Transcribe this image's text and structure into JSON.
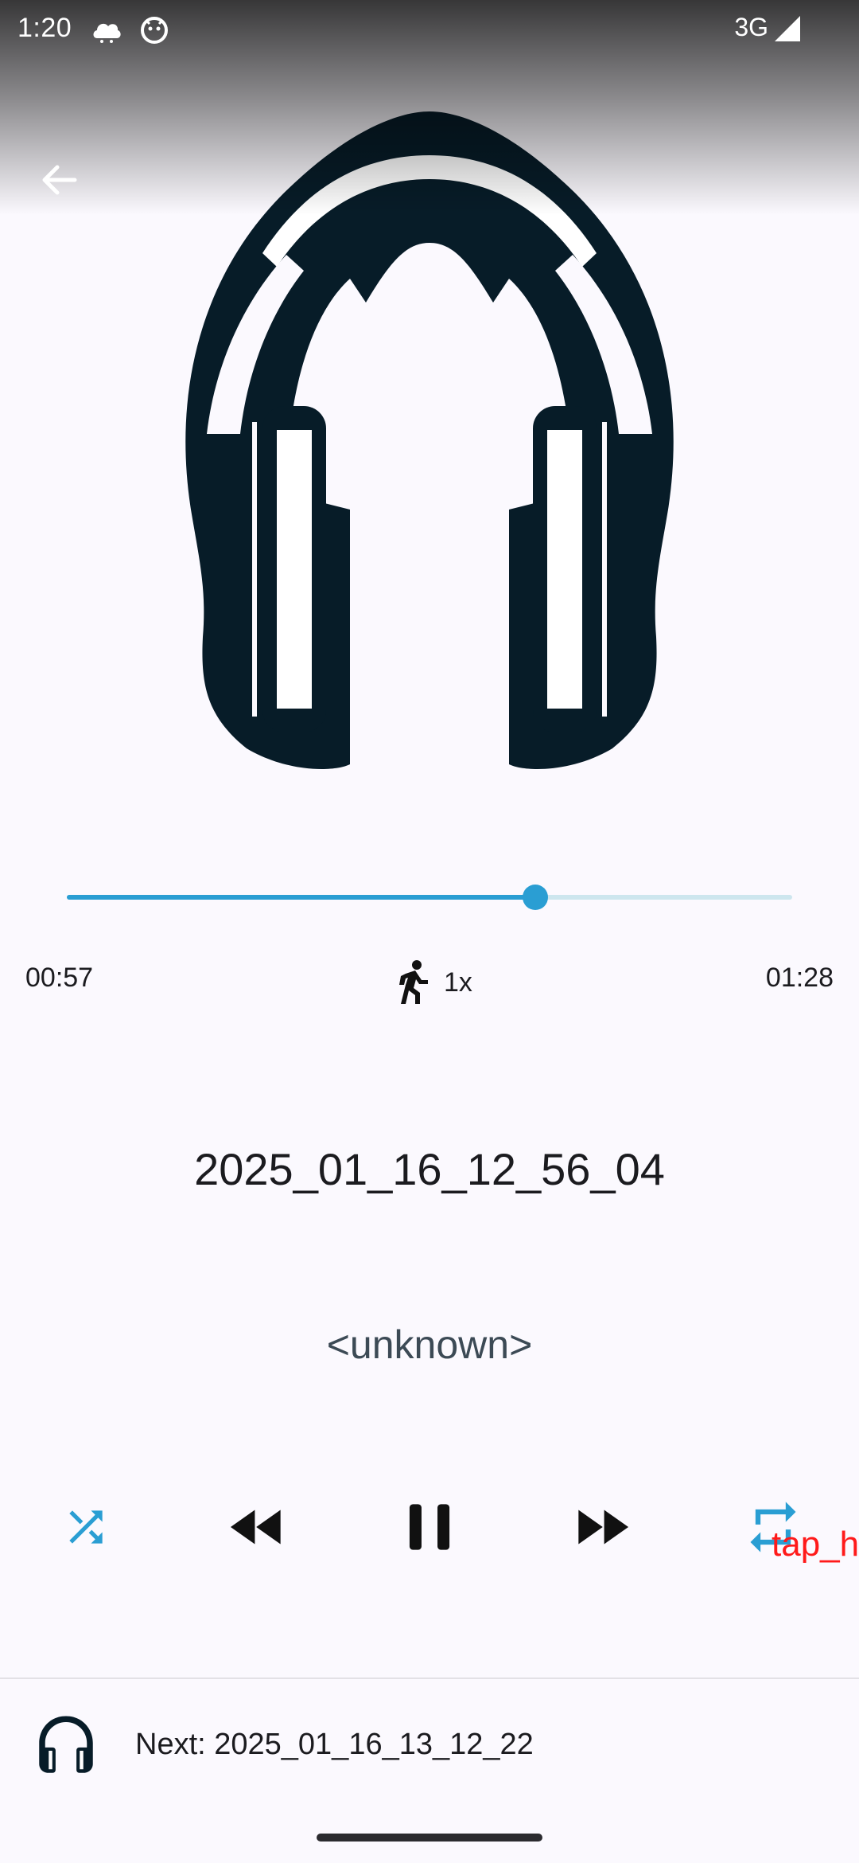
{
  "status_bar": {
    "time": "1:20",
    "network": "3G",
    "icons": [
      "cloud-icon",
      "android-debug-icon",
      "signal-icon"
    ]
  },
  "navigation": {
    "back_icon": "arrow-back-icon"
  },
  "artwork": {
    "icon": "headphones-icon"
  },
  "player": {
    "elapsed": "00:57",
    "duration": "01:28",
    "progress_fraction": 0.646,
    "speed_icon": "running-person-icon",
    "speed_label": "1x",
    "title": "2025_01_16_12_56_04",
    "artist": "<unknown>"
  },
  "controls": {
    "shuffle_icon": "shuffle-icon",
    "rewind_icon": "rewind-icon",
    "pause_icon": "pause-icon",
    "forward_icon": "fast-forward-icon",
    "repeat_icon": "repeat-icon"
  },
  "overlay": {
    "tap_hint": "tap_h"
  },
  "next": {
    "label": "Next: 2025_01_16_13_12_22",
    "icon": "headphones-icon"
  },
  "colors": {
    "accent": "#2a9ed3",
    "track_inactive": "#cde6ee",
    "icon_dark": "#071c28",
    "overlay_text": "#ff1a1a",
    "background": "#fbf9fe"
  }
}
